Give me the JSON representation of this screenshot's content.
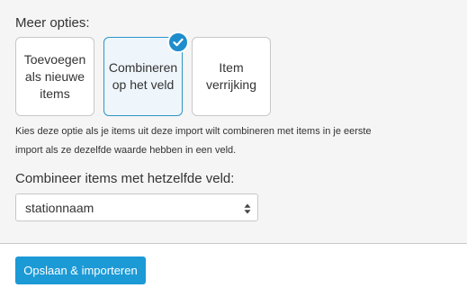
{
  "more_options": {
    "label": "Meer opties:",
    "options": [
      {
        "label": "Toevoegen als nieuwe items",
        "selected": false
      },
      {
        "label": "Combineren op het veld",
        "selected": true
      },
      {
        "label": "Item verrijking",
        "selected": false
      }
    ],
    "selected_icon": "checkmark-icon",
    "help_text": "Kies deze optie als je items uit deze import wilt combineren met items in je eerste import als ze dezelfde waarde hebben in een veld."
  },
  "combine_field": {
    "label": "Combineer items met hetzelfde veld:",
    "selected_value": "stationnaam",
    "icon": "sort-arrows-icon"
  },
  "footer": {
    "save_label": "Opslaan & importeren"
  },
  "colors": {
    "accent": "#1c9ad6",
    "selected_border": "#2e95c8",
    "selected_bg": "#eef6fc"
  }
}
